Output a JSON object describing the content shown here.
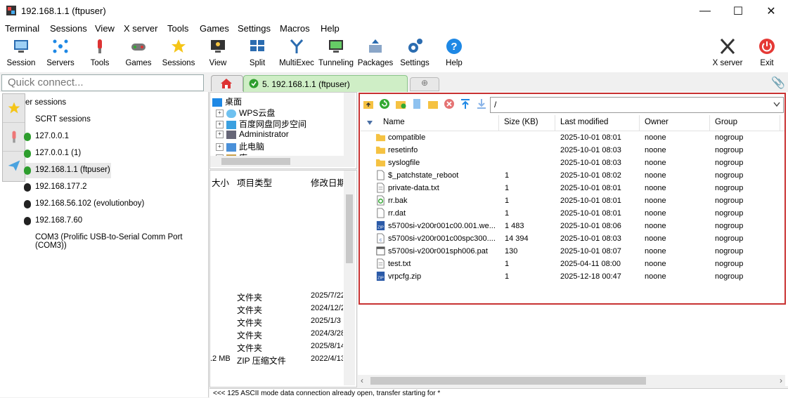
{
  "window": {
    "title": "192.168.1.1 (ftpuser)",
    "min": "—",
    "max": "☐",
    "close": "✕"
  },
  "menu": [
    "Terminal",
    "Sessions",
    "View",
    "X server",
    "Tools",
    "Games",
    "Settings",
    "Macros",
    "Help"
  ],
  "toolbar": {
    "items": [
      "Session",
      "Servers",
      "Tools",
      "Games",
      "Sessions",
      "View",
      "Split",
      "MultiExec",
      "Tunneling",
      "Packages",
      "Settings",
      "Help"
    ],
    "xserver": "X server",
    "exit": "Exit"
  },
  "quick_connect": {
    "placeholder": "Quick connect..."
  },
  "tabs": {
    "active": "5. 192.168.1.1 (ftpuser)"
  },
  "sidebar": {
    "sessions": [
      {
        "label": "er sessions",
        "color": ""
      },
      {
        "label": "SCRT sessions",
        "color": ""
      },
      {
        "label": "127.0.0.1",
        "color": "#2e9e2e"
      },
      {
        "label": "127.0.0.1 (1)",
        "color": "#2e9e2e"
      },
      {
        "label": "192.168.1.1 (ftpuser)",
        "color": "#2e9e2e"
      },
      {
        "label": "192.168.177.2",
        "color": "#222222"
      },
      {
        "label": "192.168.56.102 (evolutionboy)",
        "color": "#222222"
      },
      {
        "label": "192.168.7.60",
        "color": "#222222"
      },
      {
        "label": "COM3  (Prolific USB-to-Serial Comm Port (COM3))",
        "color": ""
      }
    ]
  },
  "local": {
    "tree": [
      "桌面",
      "WPS云盘",
      "百度网盘同步空间",
      "Administrator",
      "此电脑",
      "库"
    ],
    "headers": [
      "大小",
      "项目类型",
      "修改日期"
    ],
    "rows": [
      {
        "size": "",
        "type": "文件夹",
        "date": "2025/7/22"
      },
      {
        "size": "",
        "type": "文件夹",
        "date": "2024/12/2"
      },
      {
        "size": "",
        "type": "文件夹",
        "date": "2025/1/3"
      },
      {
        "size": "",
        "type": "文件夹",
        "date": "2024/3/28"
      },
      {
        "size": "",
        "type": "文件夹",
        "date": "2025/8/14"
      },
      {
        "size": ".2 MB",
        "type": "ZIP 压缩文件",
        "date": "2022/4/13"
      }
    ]
  },
  "remote": {
    "path": "/",
    "headers": {
      "name": "Name",
      "size": "Size (KB)",
      "modified": "Last modified",
      "owner": "Owner",
      "group": "Group"
    },
    "files": [
      {
        "name": "compatible",
        "size": "",
        "modified": "2025-10-01 08:01",
        "owner": "noone",
        "group": "nogroup",
        "icon": "folder-icon"
      },
      {
        "name": "resetinfo",
        "size": "",
        "modified": "2025-10-01 08:03",
        "owner": "noone",
        "group": "nogroup",
        "icon": "folder-icon"
      },
      {
        "name": "syslogfile",
        "size": "",
        "modified": "2025-10-01 08:03",
        "owner": "noone",
        "group": "nogroup",
        "icon": "folder-icon"
      },
      {
        "name": "$_patchstate_reboot",
        "size": "1",
        "modified": "2025-10-01 08:02",
        "owner": "noone",
        "group": "nogroup",
        "icon": "file-icon"
      },
      {
        "name": "private-data.txt",
        "size": "1",
        "modified": "2025-10-01 08:01",
        "owner": "noone",
        "group": "nogroup",
        "icon": "text-file-icon"
      },
      {
        "name": "rr.bak",
        "size": "1",
        "modified": "2025-10-01 08:01",
        "owner": "noone",
        "group": "nogroup",
        "icon": "recycle-file-icon"
      },
      {
        "name": "rr.dat",
        "size": "1",
        "modified": "2025-10-01 08:01",
        "owner": "noone",
        "group": "nogroup",
        "icon": "file-icon"
      },
      {
        "name": "s5700si-v200r001c00.001.we...",
        "size": "1 483",
        "modified": "2025-10-01 08:06",
        "owner": "noone",
        "group": "nogroup",
        "icon": "zip-file-icon"
      },
      {
        "name": "s5700si-v200r001c00spc300....",
        "size": "14 394",
        "modified": "2025-10-01 08:03",
        "owner": "noone",
        "group": "nogroup",
        "icon": "code-file-icon"
      },
      {
        "name": "s5700si-v200r001sph006.pat",
        "size": "130",
        "modified": "2025-10-01 08:07",
        "owner": "noone",
        "group": "nogroup",
        "icon": "pat-file-icon"
      },
      {
        "name": "test.txt",
        "size": "1",
        "modified": "2025-04-11 08:00",
        "owner": "noone",
        "group": "nogroup",
        "icon": "text-file-icon"
      },
      {
        "name": "vrpcfg.zip",
        "size": "1",
        "modified": "2025-12-18 00:47",
        "owner": "noone",
        "group": "nogroup",
        "icon": "zip-file-icon"
      }
    ]
  },
  "status": "<<<  125 ASCII mode data connection already open, transfer starting for *",
  "colors": {
    "highlight_border": "#c83232",
    "active_tab": "#cfeec6",
    "folder": "#f5c242"
  }
}
